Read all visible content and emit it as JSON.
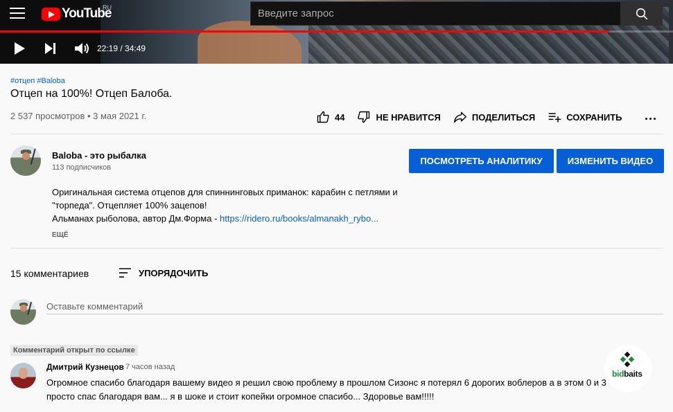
{
  "header": {
    "logo_text": "YouTube",
    "region": "RU",
    "search_placeholder": "Введите запрос"
  },
  "player": {
    "time": "22:19 / 34:49",
    "progress": 0.905
  },
  "video": {
    "tags": [
      "#отцеп",
      "#Baloba"
    ],
    "title": "Отцеп на 100%! Отцеп Балоба.",
    "views": "2 537 просмотров • 3 мая 2021 г.",
    "likes": "44",
    "dislike_label": "НЕ НРАВИТСЯ",
    "share_label": "ПОДЕЛИТЬСЯ",
    "save_label": "СОХРАНИТЬ"
  },
  "channel": {
    "name": "Baloba - это рыбалка",
    "subscribers": "113 подписчиков",
    "analytics_label": "ПОСМОТРЕТЬ АНАЛИТИКУ",
    "edit_label": "ИЗМЕНИТЬ ВИДЕО"
  },
  "description": {
    "line1": "Оригинальная система отцепов для спиннинговых приманок: карабин с петлями и",
    "line2": "\"торпеда\". Отцепляет 100% зацепов!",
    "line3": "Альманах рыболова, автор Дм.Форма - ",
    "link": "https://ridero.ru/books/almanakh_rybo...",
    "more_label": "ЕЩЁ"
  },
  "comments": {
    "count_label": "15 комментариев",
    "sort_label": "УПОРЯДОЧИТЬ",
    "input_placeholder": "Оставьте комментарий",
    "badge": "Комментарий открыт по ссылке",
    "items": [
      {
        "author": "Дмитрий Кузнецов",
        "time": "7 часов назад",
        "text": "Огромное спасибо благодаря вашему видео я решил свою проблему в прошлом Сизонс я потерял 6 дорогих воблеров а в этом 0 и 3 просто спас благодаря вам... я в шоке и стоит копейки огромное спасибо... Здоровье вам!!!!!"
      }
    ]
  },
  "watermark": {
    "text_green": "bid",
    "text_dark": "baits"
  },
  "colors": {
    "accent_blue": "#065fd4",
    "youtube_red": "#ff0000"
  }
}
